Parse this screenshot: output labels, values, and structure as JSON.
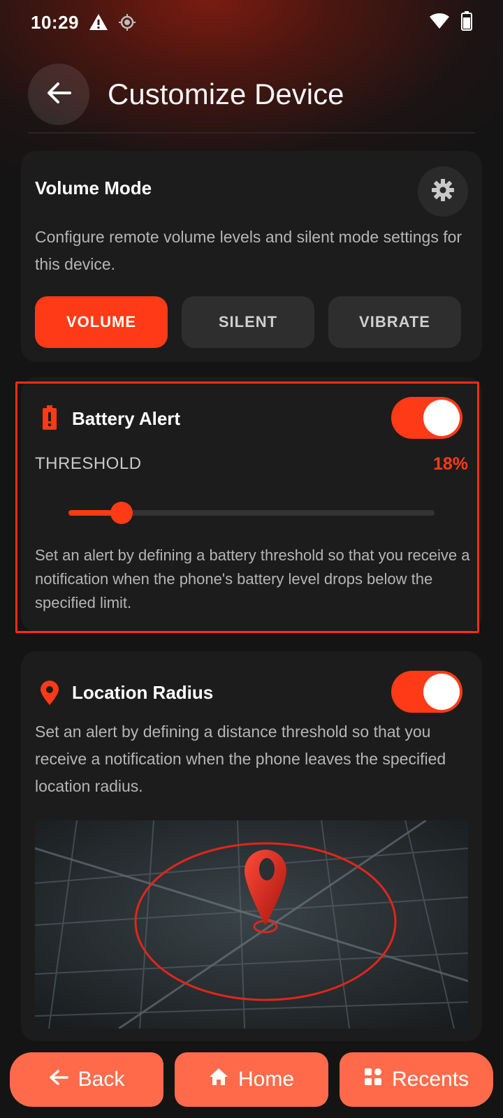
{
  "status_bar": {
    "time": "10:29",
    "icons": [
      "warning-icon",
      "location-target-icon",
      "wifi-icon",
      "battery-icon"
    ]
  },
  "header": {
    "title": "Customize Device",
    "back_icon": "arrow-left-icon"
  },
  "volume_card": {
    "title": "Volume Mode",
    "description": "Configure remote volume levels and silent mode settings for this device.",
    "modes": [
      {
        "label": "VOLUME",
        "active": true
      },
      {
        "label": "SILENT",
        "active": false
      },
      {
        "label": "VIBRATE",
        "active": false
      }
    ],
    "settings_icon": "gear-icon"
  },
  "battery_card": {
    "title": "Battery Alert",
    "enabled": true,
    "threshold_label": "THRESHOLD",
    "threshold_value": "18%",
    "slider_fraction": 0.145,
    "description": "Set an alert by defining a battery threshold so that you receive a notification when the phone's battery level drops below the specified limit."
  },
  "location_card": {
    "title": "Location Radius",
    "enabled": true,
    "description": "Set an alert by defining a distance threshold so that you receive a notification when the phone leaves the specified location radius."
  },
  "nav": {
    "back": "Back",
    "home": "Home",
    "recents": "Recents"
  },
  "colors": {
    "accent": "#ff3a17",
    "nav_button": "#ff6b4a",
    "card": "#1c1c1c",
    "background": "#141414"
  }
}
